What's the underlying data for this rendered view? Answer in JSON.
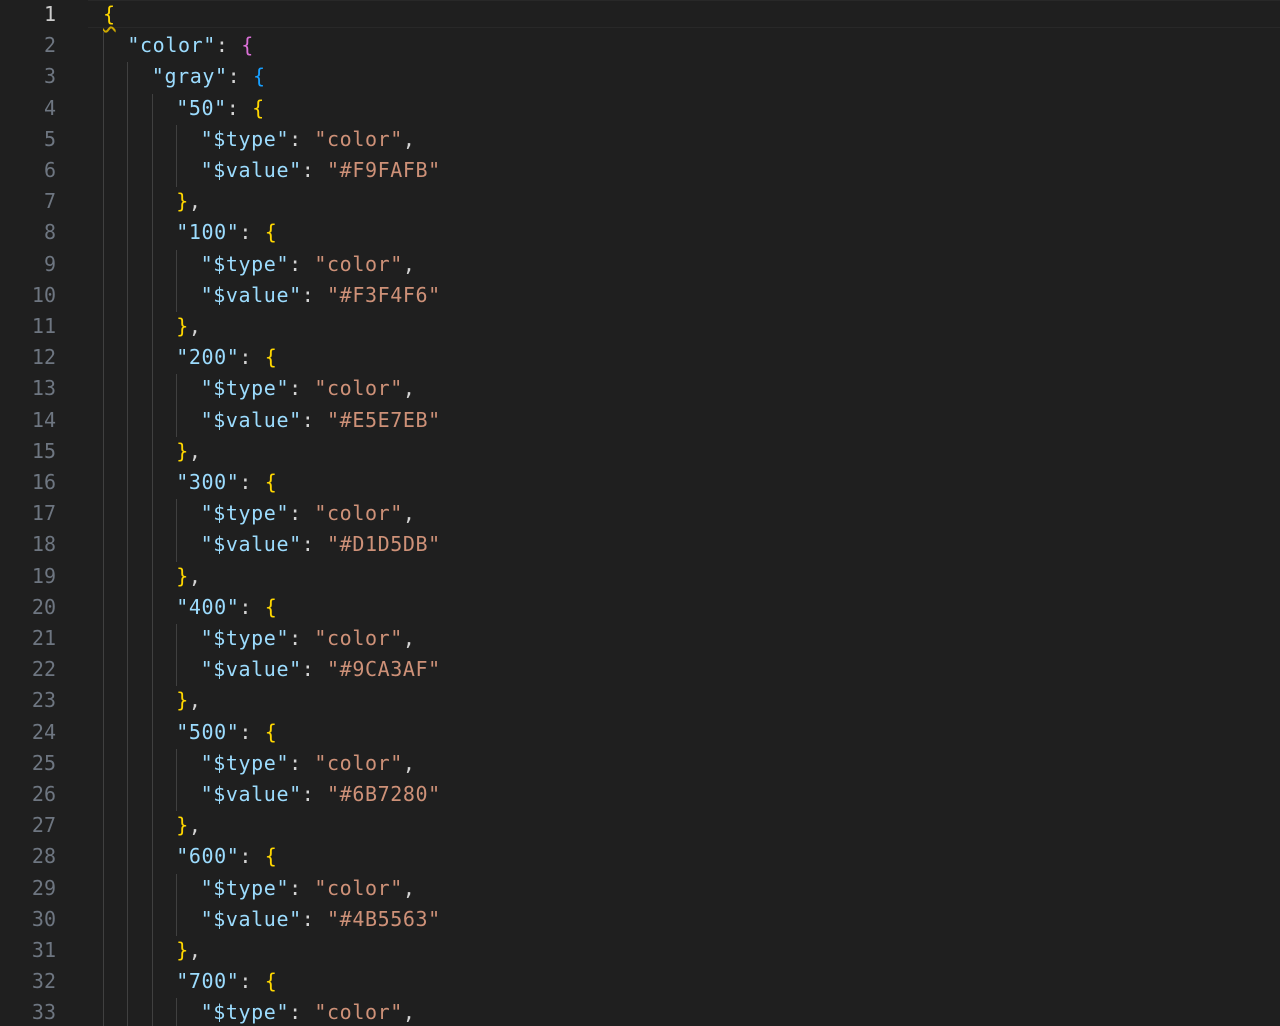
{
  "editor": {
    "language": "json",
    "active_line": 1,
    "lines": [
      {
        "n": "1",
        "indent": 0,
        "tokens": [
          {
            "t": "{",
            "c": "b1 squiggle"
          }
        ]
      },
      {
        "n": "2",
        "indent": 1,
        "tokens": [
          {
            "t": "\"color\"",
            "c": "k"
          },
          {
            "t": ": ",
            "c": "p"
          },
          {
            "t": "{",
            "c": "b2"
          }
        ]
      },
      {
        "n": "3",
        "indent": 2,
        "tokens": [
          {
            "t": "\"gray\"",
            "c": "k"
          },
          {
            "t": ": ",
            "c": "p"
          },
          {
            "t": "{",
            "c": "b3"
          }
        ]
      },
      {
        "n": "4",
        "indent": 3,
        "tokens": [
          {
            "t": "\"50\"",
            "c": "k"
          },
          {
            "t": ": ",
            "c": "p"
          },
          {
            "t": "{",
            "c": "b1"
          }
        ]
      },
      {
        "n": "5",
        "indent": 4,
        "tokens": [
          {
            "t": "\"$type\"",
            "c": "k"
          },
          {
            "t": ": ",
            "c": "p"
          },
          {
            "t": "\"color\"",
            "c": "s"
          },
          {
            "t": ",",
            "c": "p"
          }
        ]
      },
      {
        "n": "6",
        "indent": 4,
        "tokens": [
          {
            "t": "\"$value\"",
            "c": "k"
          },
          {
            "t": ": ",
            "c": "p"
          },
          {
            "t": "\"#F9FAFB\"",
            "c": "s"
          }
        ]
      },
      {
        "n": "7",
        "indent": 3,
        "tokens": [
          {
            "t": "}",
            "c": "b1"
          },
          {
            "t": ",",
            "c": "p"
          }
        ]
      },
      {
        "n": "8",
        "indent": 3,
        "tokens": [
          {
            "t": "\"100\"",
            "c": "k"
          },
          {
            "t": ": ",
            "c": "p"
          },
          {
            "t": "{",
            "c": "b1"
          }
        ]
      },
      {
        "n": "9",
        "indent": 4,
        "tokens": [
          {
            "t": "\"$type\"",
            "c": "k"
          },
          {
            "t": ": ",
            "c": "p"
          },
          {
            "t": "\"color\"",
            "c": "s"
          },
          {
            "t": ",",
            "c": "p"
          }
        ]
      },
      {
        "n": "10",
        "indent": 4,
        "tokens": [
          {
            "t": "\"$value\"",
            "c": "k"
          },
          {
            "t": ": ",
            "c": "p"
          },
          {
            "t": "\"#F3F4F6\"",
            "c": "s"
          }
        ]
      },
      {
        "n": "11",
        "indent": 3,
        "tokens": [
          {
            "t": "}",
            "c": "b1"
          },
          {
            "t": ",",
            "c": "p"
          }
        ]
      },
      {
        "n": "12",
        "indent": 3,
        "tokens": [
          {
            "t": "\"200\"",
            "c": "k"
          },
          {
            "t": ": ",
            "c": "p"
          },
          {
            "t": "{",
            "c": "b1"
          }
        ]
      },
      {
        "n": "13",
        "indent": 4,
        "tokens": [
          {
            "t": "\"$type\"",
            "c": "k"
          },
          {
            "t": ": ",
            "c": "p"
          },
          {
            "t": "\"color\"",
            "c": "s"
          },
          {
            "t": ",",
            "c": "p"
          }
        ]
      },
      {
        "n": "14",
        "indent": 4,
        "tokens": [
          {
            "t": "\"$value\"",
            "c": "k"
          },
          {
            "t": ": ",
            "c": "p"
          },
          {
            "t": "\"#E5E7EB\"",
            "c": "s"
          }
        ]
      },
      {
        "n": "15",
        "indent": 3,
        "tokens": [
          {
            "t": "}",
            "c": "b1"
          },
          {
            "t": ",",
            "c": "p"
          }
        ]
      },
      {
        "n": "16",
        "indent": 3,
        "tokens": [
          {
            "t": "\"300\"",
            "c": "k"
          },
          {
            "t": ": ",
            "c": "p"
          },
          {
            "t": "{",
            "c": "b1"
          }
        ]
      },
      {
        "n": "17",
        "indent": 4,
        "tokens": [
          {
            "t": "\"$type\"",
            "c": "k"
          },
          {
            "t": ": ",
            "c": "p"
          },
          {
            "t": "\"color\"",
            "c": "s"
          },
          {
            "t": ",",
            "c": "p"
          }
        ]
      },
      {
        "n": "18",
        "indent": 4,
        "tokens": [
          {
            "t": "\"$value\"",
            "c": "k"
          },
          {
            "t": ": ",
            "c": "p"
          },
          {
            "t": "\"#D1D5DB\"",
            "c": "s"
          }
        ]
      },
      {
        "n": "19",
        "indent": 3,
        "tokens": [
          {
            "t": "}",
            "c": "b1"
          },
          {
            "t": ",",
            "c": "p"
          }
        ]
      },
      {
        "n": "20",
        "indent": 3,
        "tokens": [
          {
            "t": "\"400\"",
            "c": "k"
          },
          {
            "t": ": ",
            "c": "p"
          },
          {
            "t": "{",
            "c": "b1"
          }
        ]
      },
      {
        "n": "21",
        "indent": 4,
        "tokens": [
          {
            "t": "\"$type\"",
            "c": "k"
          },
          {
            "t": ": ",
            "c": "p"
          },
          {
            "t": "\"color\"",
            "c": "s"
          },
          {
            "t": ",",
            "c": "p"
          }
        ]
      },
      {
        "n": "22",
        "indent": 4,
        "tokens": [
          {
            "t": "\"$value\"",
            "c": "k"
          },
          {
            "t": ": ",
            "c": "p"
          },
          {
            "t": "\"#9CA3AF\"",
            "c": "s"
          }
        ]
      },
      {
        "n": "23",
        "indent": 3,
        "tokens": [
          {
            "t": "}",
            "c": "b1"
          },
          {
            "t": ",",
            "c": "p"
          }
        ]
      },
      {
        "n": "24",
        "indent": 3,
        "tokens": [
          {
            "t": "\"500\"",
            "c": "k"
          },
          {
            "t": ": ",
            "c": "p"
          },
          {
            "t": "{",
            "c": "b1"
          }
        ]
      },
      {
        "n": "25",
        "indent": 4,
        "tokens": [
          {
            "t": "\"$type\"",
            "c": "k"
          },
          {
            "t": ": ",
            "c": "p"
          },
          {
            "t": "\"color\"",
            "c": "s"
          },
          {
            "t": ",",
            "c": "p"
          }
        ]
      },
      {
        "n": "26",
        "indent": 4,
        "tokens": [
          {
            "t": "\"$value\"",
            "c": "k"
          },
          {
            "t": ": ",
            "c": "p"
          },
          {
            "t": "\"#6B7280\"",
            "c": "s"
          }
        ]
      },
      {
        "n": "27",
        "indent": 3,
        "tokens": [
          {
            "t": "}",
            "c": "b1"
          },
          {
            "t": ",",
            "c": "p"
          }
        ]
      },
      {
        "n": "28",
        "indent": 3,
        "tokens": [
          {
            "t": "\"600\"",
            "c": "k"
          },
          {
            "t": ": ",
            "c": "p"
          },
          {
            "t": "{",
            "c": "b1"
          }
        ]
      },
      {
        "n": "29",
        "indent": 4,
        "tokens": [
          {
            "t": "\"$type\"",
            "c": "k"
          },
          {
            "t": ": ",
            "c": "p"
          },
          {
            "t": "\"color\"",
            "c": "s"
          },
          {
            "t": ",",
            "c": "p"
          }
        ]
      },
      {
        "n": "30",
        "indent": 4,
        "tokens": [
          {
            "t": "\"$value\"",
            "c": "k"
          },
          {
            "t": ": ",
            "c": "p"
          },
          {
            "t": "\"#4B5563\"",
            "c": "s"
          }
        ]
      },
      {
        "n": "31",
        "indent": 3,
        "tokens": [
          {
            "t": "}",
            "c": "b1"
          },
          {
            "t": ",",
            "c": "p"
          }
        ]
      },
      {
        "n": "32",
        "indent": 3,
        "tokens": [
          {
            "t": "\"700\"",
            "c": "k"
          },
          {
            "t": ": ",
            "c": "p"
          },
          {
            "t": "{",
            "c": "b1"
          }
        ]
      },
      {
        "n": "33",
        "indent": 4,
        "tokens": [
          {
            "t": "\"$type\"",
            "c": "k"
          },
          {
            "t": ": ",
            "c": "p"
          },
          {
            "t": "\"color\"",
            "c": "s"
          },
          {
            "t": ",",
            "c": "p"
          }
        ]
      }
    ]
  },
  "theme": {
    "background": "#1f1f1f",
    "line_number": "#6e7681",
    "line_number_active": "#cccccc",
    "key": "#9cdcfe",
    "string": "#ce9178",
    "bracket_level_1": "#ffd700",
    "bracket_level_2": "#da70d6",
    "bracket_level_3": "#179fff"
  }
}
